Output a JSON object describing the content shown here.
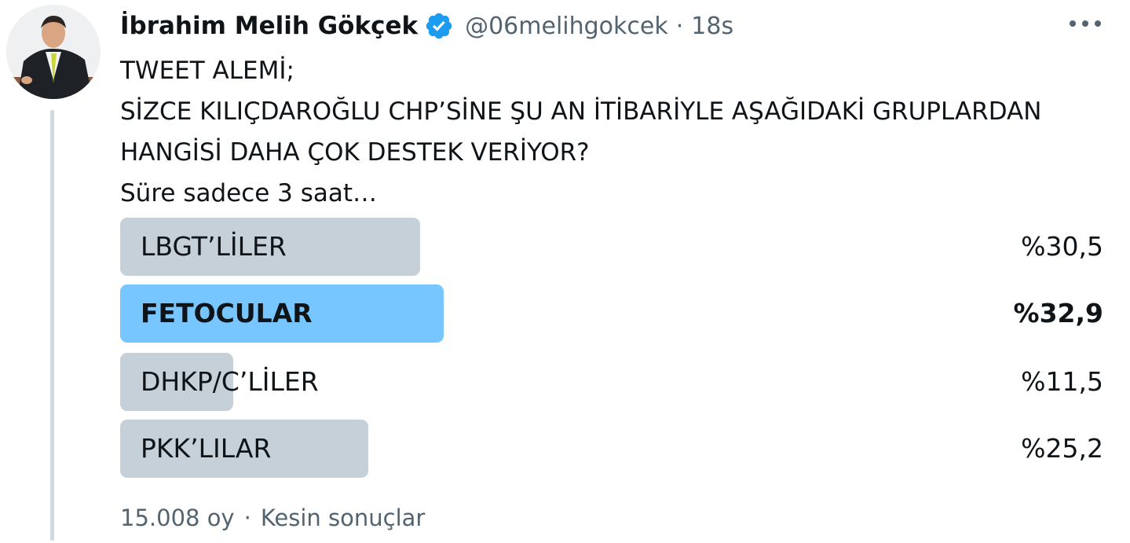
{
  "tweet": {
    "author": {
      "display_name": "İbrahim Melih Gökçek",
      "handle": "@06melihgokcek",
      "verified": true,
      "avatar_icon": "profile-photo"
    },
    "separator": "·",
    "time": "18s",
    "more_icon": "ellipsis-icon",
    "text_lines": [
      "TWEET ALEMİ;",
      "SİZCE KILIÇDAROĞLU CHP’SİNE ŞU AN İTİBARİYLE AŞAĞIDAKİ GRUPLARDAN",
      "HANGİSİ DAHA ÇOK DESTEK VERİYOR?",
      "Süre sadece 3 saat…"
    ]
  },
  "poll": {
    "options": [
      {
        "label": "LBGT’LİLER",
        "percent_text": "%30,5",
        "percent": 30.5,
        "winner": false
      },
      {
        "label": "FETOCULAR",
        "percent_text": "%32,9",
        "percent": 32.9,
        "winner": true
      },
      {
        "label": "DHKP/C’LİLER",
        "percent_text": "%11,5",
        "percent": 11.5,
        "winner": false
      },
      {
        "label": "PKK’LILAR",
        "percent_text": "%25,2",
        "percent": 25.2,
        "winner": false
      }
    ],
    "votes": "15.008 oy",
    "separator": "·",
    "status": "Kesin sonuçlar"
  },
  "colors": {
    "bar": "#c5d0d9",
    "winner_bar": "#78c6ff",
    "verified_badge": "#1d9bf0",
    "text_primary": "#0f1419",
    "text_secondary": "#536471"
  }
}
